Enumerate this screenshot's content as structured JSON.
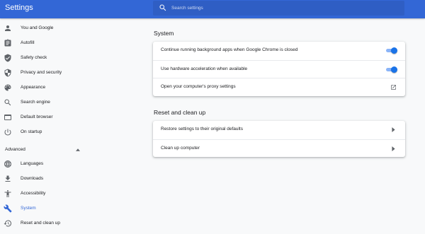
{
  "app": {
    "title": "Settings"
  },
  "search": {
    "placeholder": "Search settings",
    "icon": "search-icon"
  },
  "colors": {
    "header": "#3367d6",
    "accent": "#1a73e8",
    "toggle_track": "#8ab4f8"
  },
  "sidebar": {
    "items": [
      {
        "label": "You and Google",
        "icon": "person-icon"
      },
      {
        "label": "Autofill",
        "icon": "clipboard-icon"
      },
      {
        "label": "Safety check",
        "icon": "shield-check-icon"
      },
      {
        "label": "Privacy and security",
        "icon": "shield-icon"
      },
      {
        "label": "Appearance",
        "icon": "palette-icon"
      },
      {
        "label": "Search engine",
        "icon": "search-icon"
      },
      {
        "label": "Default browser",
        "icon": "browser-icon"
      },
      {
        "label": "On startup",
        "icon": "power-icon"
      }
    ],
    "advanced_label": "Advanced",
    "advanced_items": [
      {
        "label": "Languages",
        "icon": "globe-icon"
      },
      {
        "label": "Downloads",
        "icon": "download-icon"
      },
      {
        "label": "Accessibility",
        "icon": "accessibility-icon"
      },
      {
        "label": "System",
        "icon": "wrench-icon",
        "selected": true
      },
      {
        "label": "Reset and clean up",
        "icon": "restore-icon"
      }
    ]
  },
  "main": {
    "system": {
      "title": "System",
      "rows": [
        {
          "label": "Continue running background apps when Google Chrome is closed",
          "control": "toggle",
          "checked": true
        },
        {
          "label": "Use hardware acceleration when available",
          "control": "toggle",
          "checked": true
        },
        {
          "label": "Open your computer's proxy settings",
          "control": "external-link-icon"
        }
      ]
    },
    "reset": {
      "title": "Reset and clean up",
      "rows": [
        {
          "label": "Restore settings to their original defaults",
          "control": "chevron-right-icon"
        },
        {
          "label": "Clean up computer",
          "control": "chevron-right-icon"
        }
      ]
    }
  }
}
